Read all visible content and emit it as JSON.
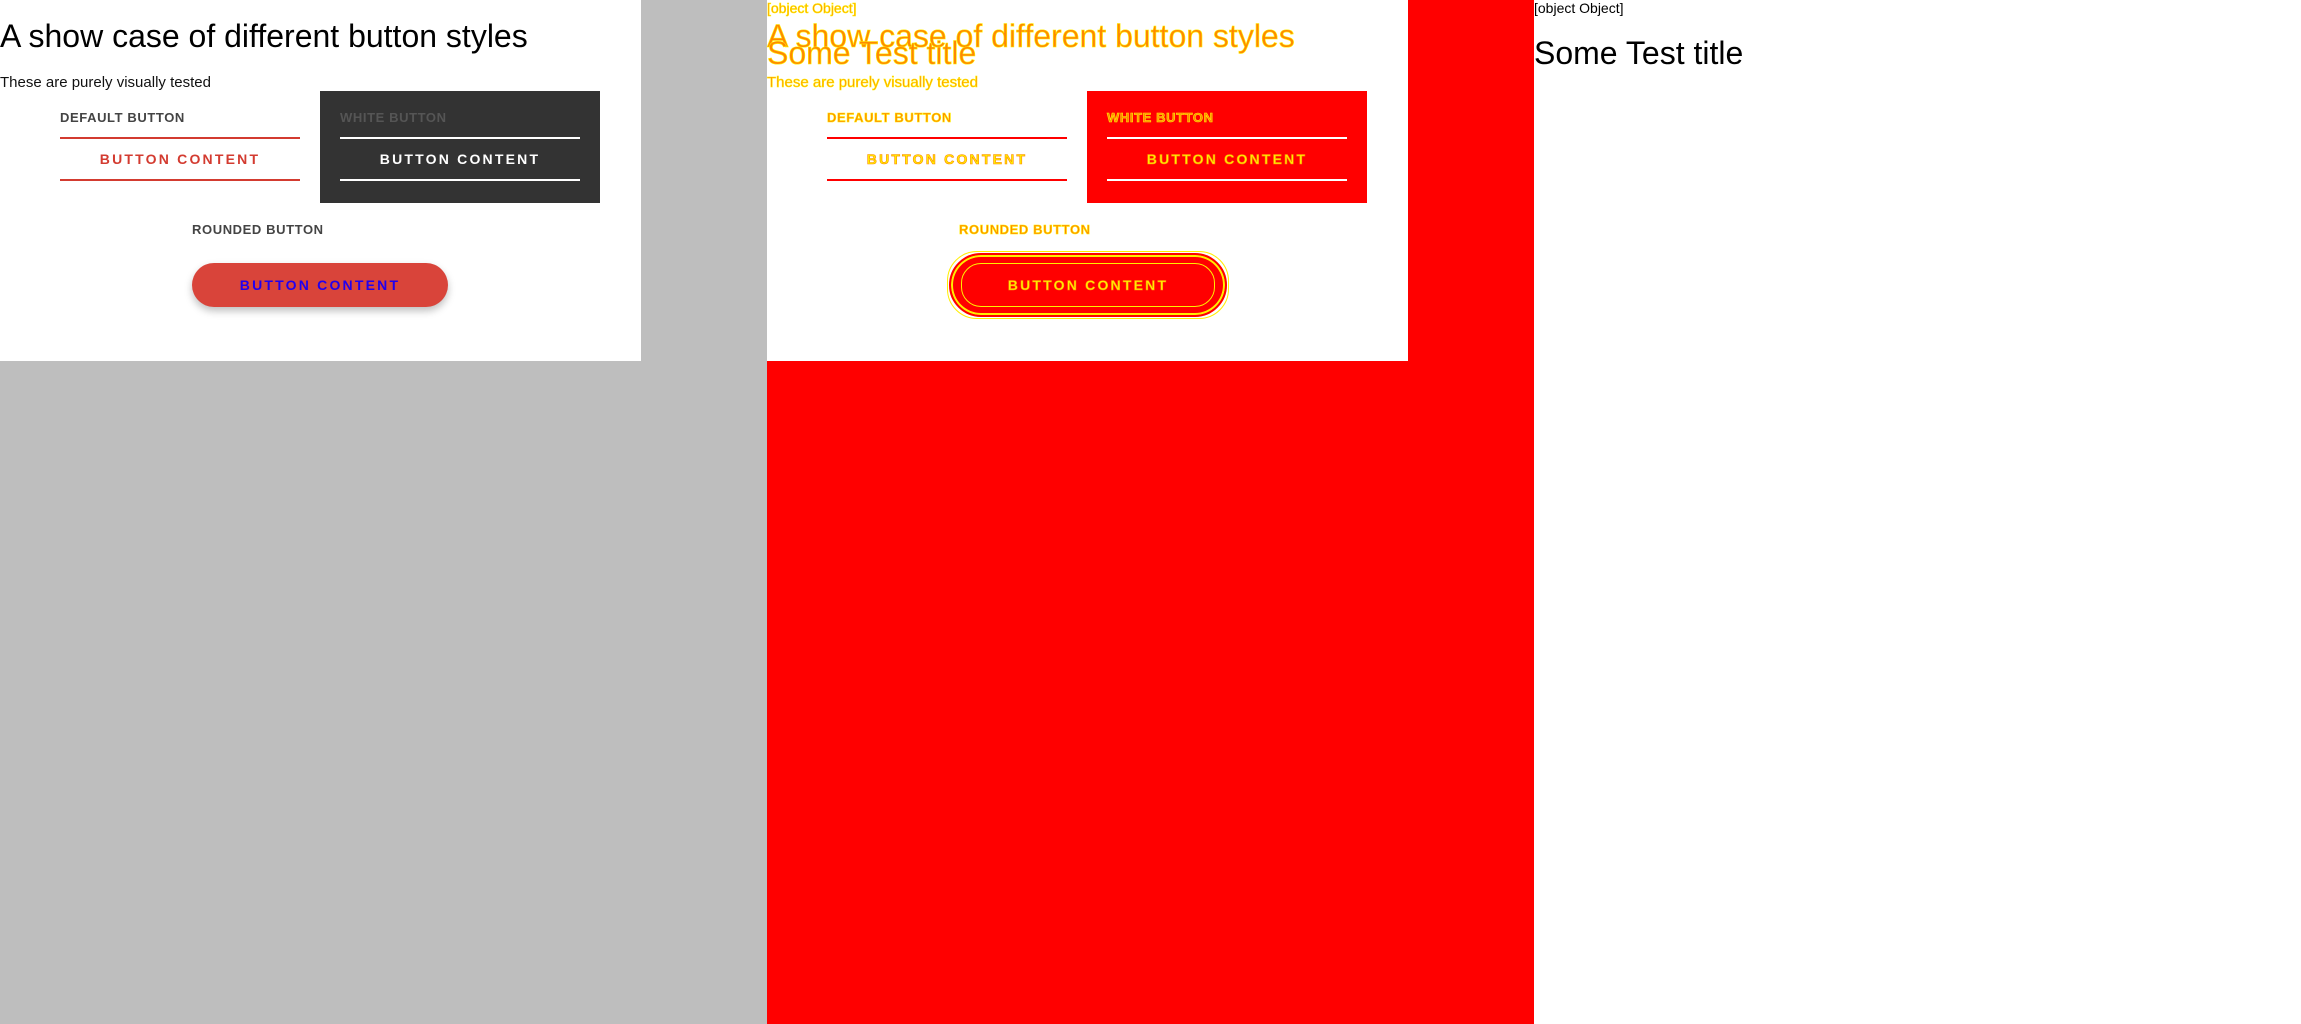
{
  "panel1": {
    "title": "A show case of different button styles",
    "subtitle": "These are purely visually tested",
    "default_label": "DEFAULT BUTTON",
    "default_button": "BUTTON CONTENT",
    "white_label": "WHITE BUTTON",
    "white_button": "BUTTON CONTENT",
    "rounded_label": "ROUNDED BUTTON",
    "rounded_button": "BUTTON CONTENT"
  },
  "panel2": {
    "object_text": "[object Object]",
    "title": "A show case of different button styles",
    "test_title": "Some Test title",
    "subtitle": "These are purely visually tested",
    "default_label": "DEFAULT BUTTON",
    "default_button": "BUTTON CONTENT",
    "white_label": "WHITE BUTTON",
    "white_button": "BUTTON CONTENT",
    "rounded_label": "ROUNDED BUTTON",
    "rounded_button": "BUTTON CONTENT"
  },
  "panel3": {
    "object_text": "[object Object]",
    "test_title": "Some Test title"
  },
  "colors": {
    "accent_red": "#d33b30",
    "dark_box": "#333333",
    "diff_red": "#ff0000",
    "diff_text": "#ff8800",
    "gray_bg": "#bebebe",
    "rounded_text": "#2200ee"
  }
}
